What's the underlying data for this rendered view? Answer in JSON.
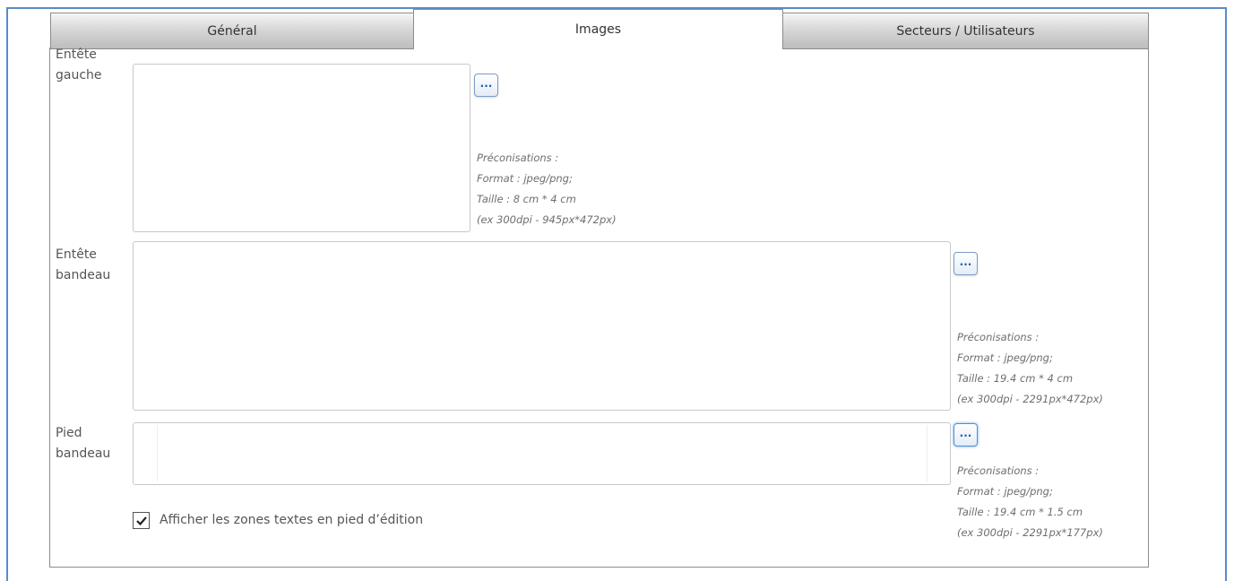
{
  "tabs": [
    {
      "label": "Général",
      "active": false
    },
    {
      "label": "Images",
      "active": true
    },
    {
      "label": "Secteurs / Utilisateurs",
      "active": false
    }
  ],
  "fields": [
    {
      "label_line1": "Entête",
      "label_line2": "gauche",
      "button_label": "...",
      "hints": [
        "Préconisations :",
        "Format : jpeg/png;",
        "Taille : 8 cm * 4 cm",
        "(ex 300dpi - 945px*472px)"
      ]
    },
    {
      "label_line1": "Entête",
      "label_line2": "bandeau",
      "button_label": "...",
      "hints": [
        "Préconisations :",
        "Format : jpeg/png;",
        "Taille : 19.4 cm * 4 cm",
        "(ex 300dpi - 2291px*472px)"
      ]
    },
    {
      "label_line1": "Pied",
      "label_line2": "bandeau",
      "button_label": "...",
      "hints": [
        "Préconisations :",
        "Format : jpeg/png;",
        "Taille : 19.4 cm * 1.5 cm",
        "(ex 300dpi - 2291px*177px)"
      ]
    }
  ],
  "checkbox": {
    "label": "Afficher les zones textes en pied d’édition",
    "checked": true
  },
  "colors": {
    "frame_border": "#5b8bc9",
    "button_text": "#1f5fa8"
  }
}
